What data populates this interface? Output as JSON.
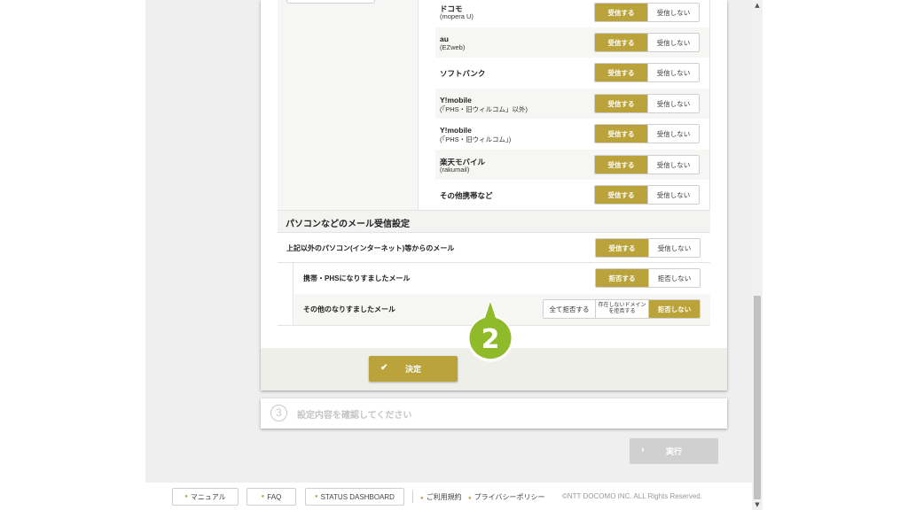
{
  "carriers": [
    {
      "name": "ドコモ",
      "sub": "(mopera U)"
    },
    {
      "name": "au",
      "sub": "(EZweb)"
    },
    {
      "name": "ソフトバンク",
      "sub": ""
    },
    {
      "name": "Y!mobile",
      "sub": "(「PHS・旧ウィルコム」以外)"
    },
    {
      "name": "Y!mobile",
      "sub": "(「PHS・旧ウィルコム」)"
    },
    {
      "name": "楽天モバイル",
      "sub": "(rakumail)"
    },
    {
      "name": "その他携帯など",
      "sub": ""
    }
  ],
  "toggle": {
    "receive": "受信する",
    "reject": "受信しない"
  },
  "pc_section": {
    "title": "パソコンなどのメール受信設定",
    "pc_mail_label": "上記以外のパソコン(インターネット)等からのメール",
    "spoof_mobile_label": "携帯・PHSになりすましたメール",
    "spoof_mobile_on": "拒否する",
    "spoof_mobile_off": "拒否しない",
    "spoof_other_label": "その他のなりすましたメール",
    "spoof_other_opt1": "全て拒否する",
    "spoof_other_opt2_line1": "存在しないドメイン",
    "spoof_other_opt2_line2": "を拒否する",
    "spoof_other_opt3": "拒否しない"
  },
  "decide_button": {
    "label": "決定",
    "icon": "check-icon"
  },
  "marker": {
    "number": "2",
    "color": "#8fba2a"
  },
  "step3": {
    "number": "3",
    "title": "設定内容を確認してください"
  },
  "execute_button": {
    "label": "実行",
    "icon": "chevron-right-icon"
  },
  "footer": {
    "manual": "マニュアル",
    "faq": "FAQ",
    "status": "STATUS DASHBOARD",
    "terms": "ご利用規約",
    "privacy": "プライバシーポリシー",
    "copyright": "©NTT DOCOMO INC. ALL Rights Reserved."
  },
  "colors": {
    "accent": "#b9a33a",
    "marker": "#8fba2a",
    "disabled": "#d0d0d0"
  }
}
